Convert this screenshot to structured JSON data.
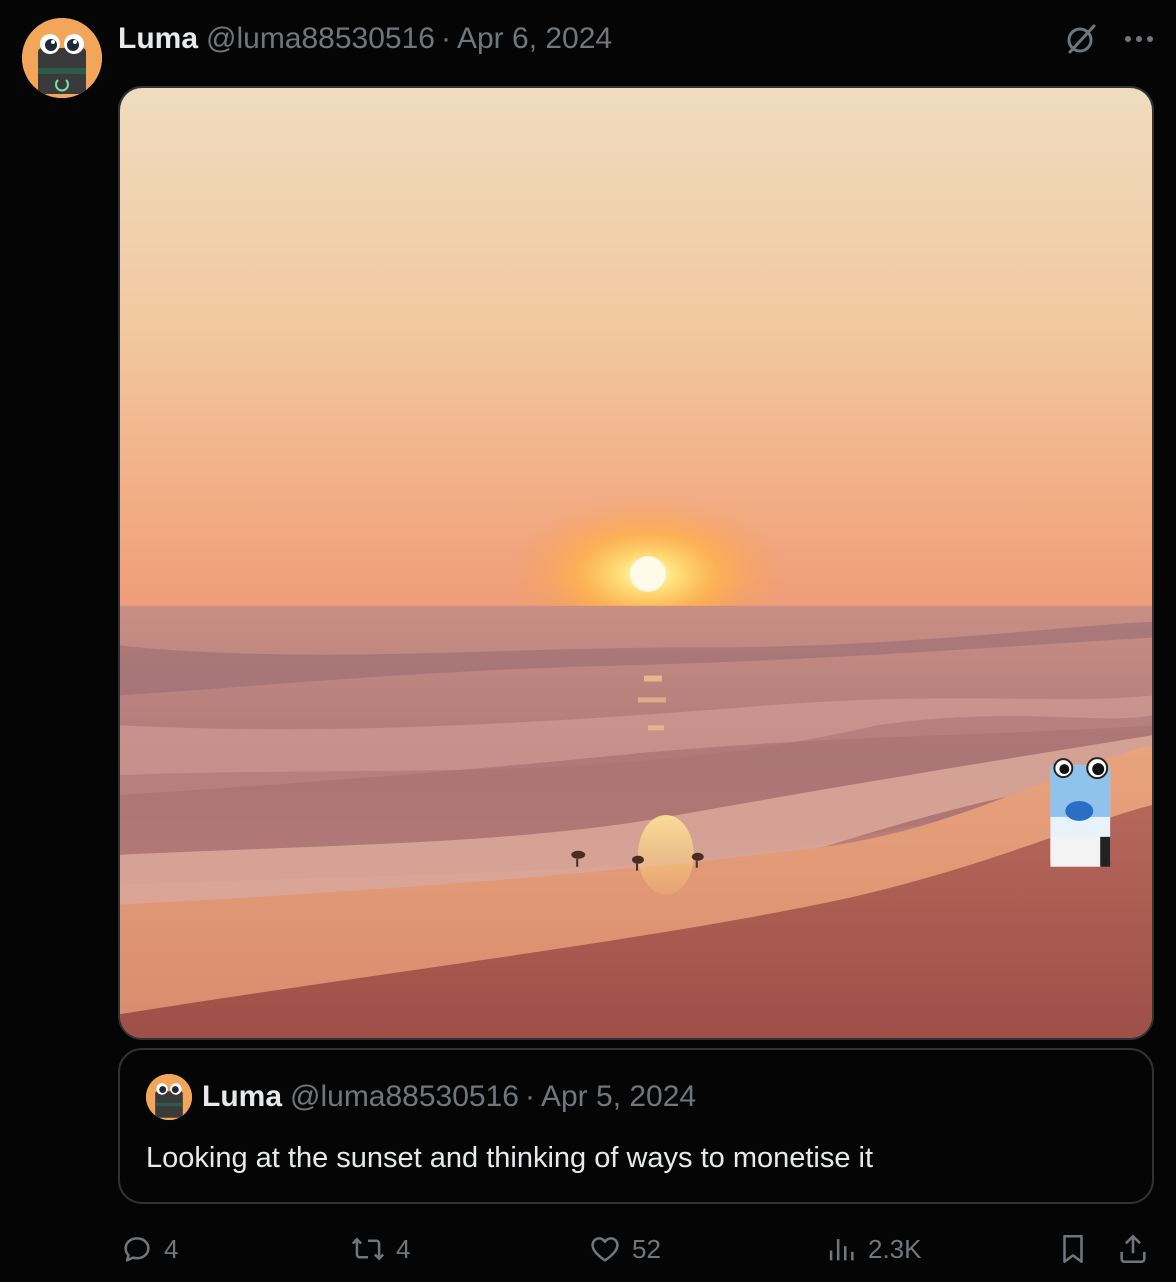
{
  "tweet": {
    "author_name": "Luma",
    "author_handle": "@luma88530516",
    "separator": "·",
    "date": "Apr 6, 2024",
    "avatar_icon": "mascot-avatar-icon",
    "media_alt": "Sunset over the ocean with waves on a beach and shorebirds, a small cartoon cigarette-pack mascot with big eyes on the right"
  },
  "quote": {
    "author_name": "Luma",
    "author_handle": "@luma88530516",
    "separator": "·",
    "date": "Apr 5, 2024",
    "text": "Looking at the sunset and thinking of ways to monetise it"
  },
  "actions": {
    "replies": "4",
    "retweets": "4",
    "likes": "52",
    "views": "2.3K"
  },
  "colors": {
    "background": "#050505",
    "text_primary": "#e7e9ea",
    "text_secondary": "#71767b",
    "border": "#2f3336"
  }
}
